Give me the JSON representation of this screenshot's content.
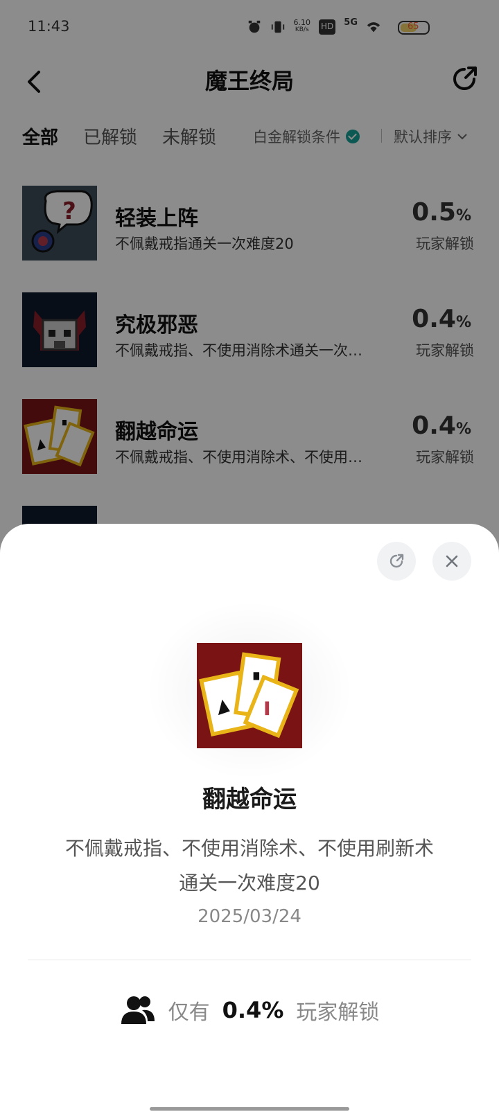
{
  "status_bar": {
    "time": "11:43",
    "net_speed_value": "6.10",
    "net_speed_unit": "KB/s",
    "hd": "HD",
    "signal": "5G",
    "battery": "65"
  },
  "header": {
    "title": "魔王终局"
  },
  "tabs": [
    {
      "label": "全部"
    },
    {
      "label": "已解锁"
    },
    {
      "label": "未解锁"
    }
  ],
  "filter": {
    "platinum_label": "白金解锁条件",
    "sort_label": "默认排序"
  },
  "achievements": [
    {
      "title": "轻装上阵",
      "desc": "不佩戴戒指通关一次难度20",
      "pct": "0.5",
      "unit": "%",
      "sub": "玩家解锁"
    },
    {
      "title": "究极邪恶",
      "desc": "不佩戴戒指、不使用消除术通关一次…",
      "pct": "0.4",
      "unit": "%",
      "sub": "玩家解锁"
    },
    {
      "title": "翻越命运",
      "desc": "不佩戴戒指、不使用消除术、不使用…",
      "pct": "0.4",
      "unit": "%",
      "sub": "玩家解锁"
    }
  ],
  "sheet": {
    "title": "翻越命运",
    "desc_line1": "不佩戴戒指、不使用消除术、不使用刷新术",
    "desc_line2": "通关一次难度20",
    "date": "2025/03/24",
    "stat_prefix": "仅有",
    "stat_value": "0.4%",
    "stat_suffix": "玩家解锁"
  },
  "icons": {
    "back": "chevron-left-icon",
    "share": "share-icon",
    "close": "close-icon",
    "users": "users-icon",
    "verified": "check-badge-icon"
  },
  "colors": {
    "accent_teal": "#17a39a",
    "dim_overlay": "rgba(0,0,0,0.45)"
  }
}
